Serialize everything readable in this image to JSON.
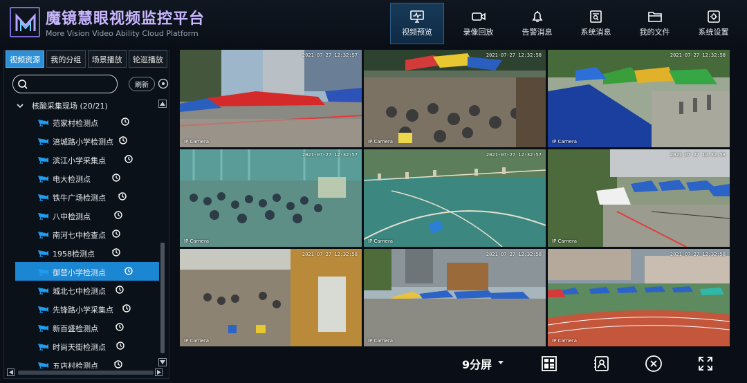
{
  "brand": {
    "title": "魔镜慧眼视频监控平台",
    "subtitle": "More Vision Video Ability Cloud Platform",
    "logo_letter": "M"
  },
  "nav": [
    {
      "label": "视频预览",
      "icon": "monitor-icon",
      "active": true
    },
    {
      "label": "录像回放",
      "icon": "video-camera-icon"
    },
    {
      "label": "告警消息",
      "icon": "bell-icon"
    },
    {
      "label": "系统消息",
      "icon": "message-search-icon"
    },
    {
      "label": "我的文件",
      "icon": "folder-icon"
    },
    {
      "label": "系统设置",
      "icon": "settings-icon"
    }
  ],
  "sidebar": {
    "tabs": [
      "视频资源",
      "我的分组",
      "场景播放",
      "轮巡播放"
    ],
    "active_tab": "视频资源",
    "search_placeholder": "",
    "refresh_label": "刷新",
    "group_label": "核酸采集现场 (20/21)",
    "items": [
      {
        "label": "范家村检测点"
      },
      {
        "label": "涪城路小学检测点"
      },
      {
        "label": "滨江小学采集点"
      },
      {
        "label": "电大检测点"
      },
      {
        "label": "铁牛广场检测点"
      },
      {
        "label": "八中检测点"
      },
      {
        "label": "南河七中检查点"
      },
      {
        "label": "1958检测点"
      },
      {
        "label": "御营小学检测点",
        "selected": true
      },
      {
        "label": "城北七中检测点"
      },
      {
        "label": "先锋路小学采集点"
      },
      {
        "label": "新百盛检测点"
      },
      {
        "label": "时尚天街检测点"
      },
      {
        "label": "五店村检测点"
      }
    ]
  },
  "grid": {
    "cells": [
      {
        "timestamp": "2021-07-27 12:32:57",
        "camera": "IP Camera",
        "scene": "street-tents"
      },
      {
        "timestamp": "2021-07-27 12:32:58",
        "camera": "IP Camera",
        "scene": "crowd-tents"
      },
      {
        "timestamp": "2021-07-27 12:32:58",
        "camera": "IP Camera",
        "scene": "tent-queue"
      },
      {
        "timestamp": "2021-07-27 12:32:57",
        "camera": "IP Camera",
        "scene": "hall-crowd"
      },
      {
        "timestamp": "2021-07-27 12:32:57",
        "camera": "IP Camera",
        "scene": "sports-court"
      },
      {
        "timestamp": "2021-07-27 12:32:58",
        "camera": "IP Camera",
        "scene": "courtyard-tents"
      },
      {
        "timestamp": "2021-07-27 12:32:58",
        "camera": "IP Camera",
        "scene": "corridor"
      },
      {
        "timestamp": "2021-07-27 12:32:58",
        "camera": "IP Camera",
        "scene": "plaza-tents"
      },
      {
        "timestamp": "2021-07-27 12:32:58",
        "camera": "IP Camera",
        "scene": "stadium-tents"
      }
    ]
  },
  "toolbar": {
    "layout_label": "9分屏",
    "buttons": [
      "layout-grid-icon",
      "user-portrait-icon",
      "close-circle-icon",
      "fullscreen-icon"
    ]
  }
}
